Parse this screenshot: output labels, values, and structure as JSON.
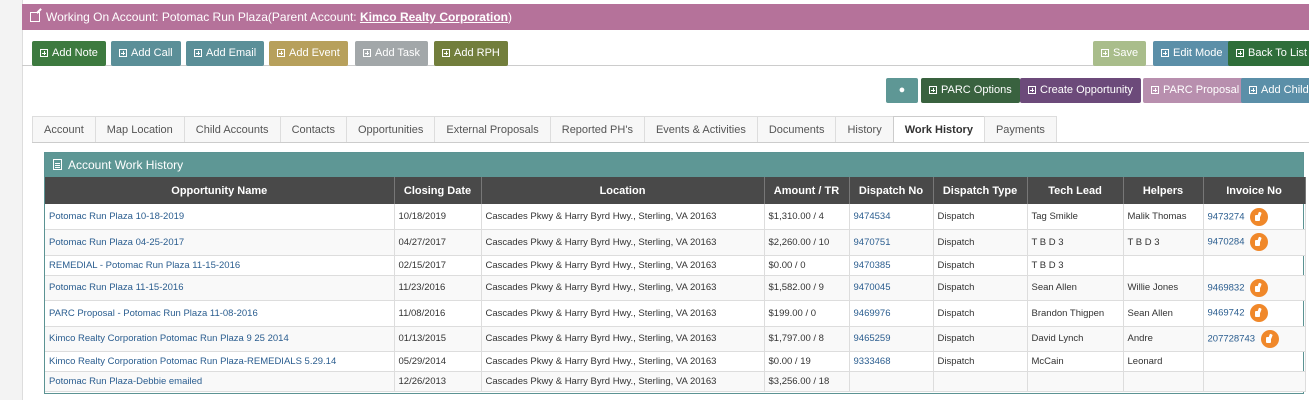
{
  "header": {
    "prefix": "Working On Account: Potomac Run Plaza(Parent Account: ",
    "parent_link": "Kimco Realty Corporation",
    "suffix": ")"
  },
  "toolbar": {
    "add_note": "Add Note",
    "add_call": "Add Call",
    "add_email": "Add Email",
    "add_event": "Add Event",
    "add_task": "Add Task",
    "add_rph": "Add RPH",
    "save": "Save",
    "edit_mode": "Edit Mode",
    "back_to_list": "Back To List"
  },
  "toolbar2": {
    "parc_options": "PARC Options",
    "create_opportunity": "Create Opportunity",
    "parc_proposal": "PARC Proposal",
    "add_child": "Add Child"
  },
  "tabs": [
    "Account",
    "Map Location",
    "Child Accounts",
    "Contacts",
    "Opportunities",
    "External Proposals",
    "Reported PH's",
    "Events & Activities",
    "Documents",
    "History",
    "Work History",
    "Payments"
  ],
  "panel": {
    "title": "Account Work History",
    "columns": [
      "Opportunity Name",
      "Closing Date",
      "Location",
      "Amount / TR",
      "Dispatch No",
      "Dispatch Type",
      "Tech Lead",
      "Helpers",
      "Invoice No"
    ],
    "rows": [
      [
        "Potomac Run Plaza 10-18-2019",
        "10/18/2019",
        "Cascades Pkwy & Harry Byrd Hwy., Sterling, VA 20163",
        "$1,310.00 / 4",
        "9474534",
        "Dispatch",
        "Tag Smikle",
        "Malik Thomas",
        "9473274"
      ],
      [
        "Potomac Run Plaza 04-25-2017",
        "04/27/2017",
        "Cascades Pkwy & Harry Byrd Hwy., Sterling, VA 20163",
        "$2,260.00 / 10",
        "9470751",
        "Dispatch",
        "T B D 3",
        "T B D 3",
        "9470284"
      ],
      [
        "REMEDIAL - Potomac Run Plaza 11-15-2016",
        "02/15/2017",
        "Cascades Pkwy & Harry Byrd Hwy., Sterling, VA 20163",
        "$0.00 / 0",
        "9470385",
        "Dispatch",
        "T B D 3",
        "",
        ""
      ],
      [
        "Potomac Run Plaza 11-15-2016",
        "11/23/2016",
        "Cascades Pkwy & Harry Byrd Hwy., Sterling, VA 20163",
        "$1,582.00 / 9",
        "9470045",
        "Dispatch",
        "Sean Allen",
        "Willie Jones",
        "9469832"
      ],
      [
        "PARC Proposal - Potomac Run Plaza 11-08-2016",
        "11/08/2016",
        "Cascades Pkwy & Harry Byrd Hwy., Sterling, VA 20163",
        "$199.00 / 0",
        "9469976",
        "Dispatch",
        "Brandon Thigpen",
        "Sean Allen",
        "9469742"
      ],
      [
        "Kimco Realty Corporation Potomac Run Plaza 9 25 2014",
        "01/13/2015",
        "Cascades Pkwy & Harry Byrd Hwy., Sterling, VA 20163",
        "$1,797.00 / 8",
        "9465259",
        "Dispatch",
        "David Lynch",
        "Andre",
        "207728743"
      ],
      [
        "Kimco Realty Corporation Potomac Run Plaza-REMEDIALS 5.29.14",
        "05/29/2014",
        "Cascades Pkwy & Harry Byrd Hwy., Sterling, VA 20163",
        "$0.00 / 19",
        "9333468",
        "Dispatch",
        "McCain",
        "Leonard",
        ""
      ],
      [
        "Potomac Run Plaza-Debbie emailed",
        "12/26/2013",
        "Cascades Pkwy & Harry Byrd Hwy., Sterling, VA 20163",
        "$3,256.00 / 18",
        "",
        "",
        "",
        "",
        ""
      ]
    ]
  },
  "colors": {
    "title_bar": "#b5729a",
    "panel_head": "#5e9795",
    "table_head": "#494949",
    "link": "#2a5d8f",
    "thumb": "#f0882a"
  }
}
